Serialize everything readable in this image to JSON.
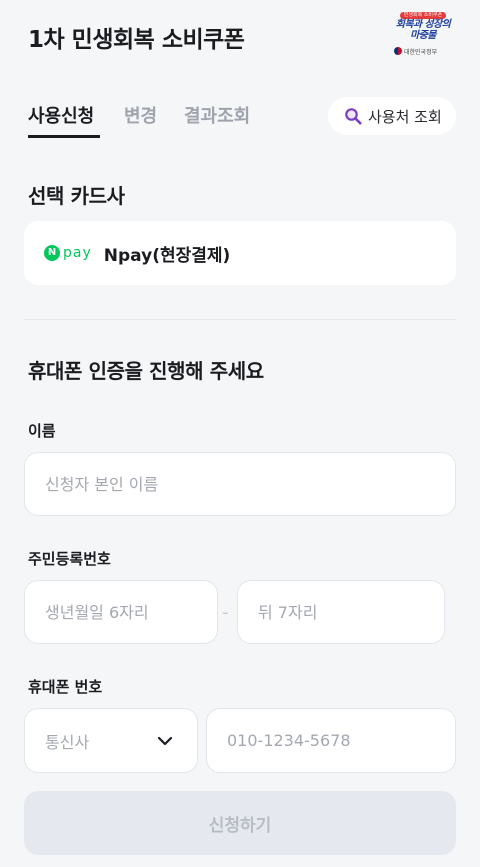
{
  "header": {
    "title": "1차 민생회복 소비쿠폰",
    "logo": {
      "top_text": "민생회복 소비쿠폰",
      "line1": "회복과 성장의",
      "line2": "마중물",
      "gov_text": "대한민국정부"
    }
  },
  "tabs": [
    {
      "label": "사용신청",
      "active": true
    },
    {
      "label": "변경",
      "active": false
    },
    {
      "label": "결과조회",
      "active": false
    }
  ],
  "lookup_button": {
    "icon": "search-icon",
    "label": "사용처 조회"
  },
  "card_section": {
    "title": "선택 카드사",
    "selected": {
      "logo_n": "N",
      "logo_text": "pay",
      "label": "Npay(현장결제)"
    }
  },
  "verify_section": {
    "title": "휴대폰 인증을 진행해 주세요",
    "name": {
      "label": "이름",
      "placeholder": "신청자 본인 이름",
      "value": ""
    },
    "rrn": {
      "label": "주민등록번호",
      "birth_placeholder": "생년월일 6자리",
      "separator": "-",
      "back_placeholder": "뒤 7자리"
    },
    "phone": {
      "label": "휴대폰 번호",
      "carrier_value": "통신사",
      "number_placeholder": "010-1234-5678"
    }
  },
  "submit_button": {
    "label": "신청하기",
    "enabled": false
  },
  "colors": {
    "background": "#f5f6f8",
    "text_primary": "#1b1c20",
    "text_muted": "#9ea3ad",
    "npay_green": "#03c75a",
    "search_icon": "#7b3fc4",
    "logo_blue": "#1f3f9c",
    "logo_red": "#e43b3b",
    "button_disabled_bg": "#e5e9ef",
    "button_disabled_text": "#b7bcc5"
  }
}
